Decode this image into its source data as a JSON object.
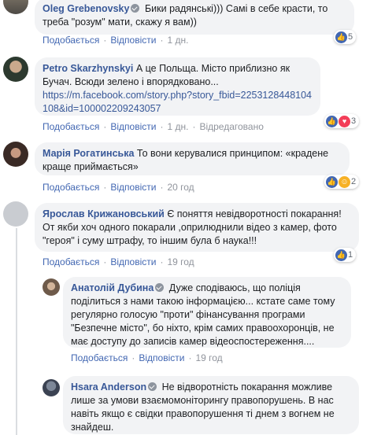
{
  "comments": [
    {
      "author": "Oleg Grebenovsky",
      "text": "Бики радянські))) Самі в себе красти, то треба \"розум\" мати, скажу я вам))",
      "like": "Подобається",
      "reply": "Відповісти",
      "time": "1 дн.",
      "reactions_count": "5"
    },
    {
      "author": "Petro Skarzhynskyi",
      "text": "А це Польща. Місто приблизно як Бучач. Всюди зелено і впорядковано...",
      "link": "https://m.facebook.com/story.php?story_fbid=2253128448104108&id=100002209243057",
      "like": "Подобається",
      "reply": "Відповісти",
      "time": "1 дн.",
      "edited": "Відредаговано",
      "reactions_count": "3"
    },
    {
      "author": "Марія Рогатинська",
      "text": "То вони керувалися принципом: «крадене краще приймається»",
      "like": "Подобається",
      "reply": "Відповісти",
      "time": "20 год",
      "reactions_count": "2"
    },
    {
      "author": "Ярослав Крижановський",
      "text": "Є поняття невідворотності покарання! От якби хоч одного покарали ,оприлюднили відео з камер, фото \"героя\" і суму штрафу, то іншим була б наука!!!",
      "like": "Подобається",
      "reply": "Відповісти",
      "time": "19 год",
      "reactions_count": "1"
    },
    {
      "author": "Анатолій Дубина",
      "text": "Дуже сподіваюсь, що поліція поділиться з нами такою інформацією... кстате саме тому регулярно голосую \"проти\" фінансування програми \"Безпечне місто\", бо ніхто, крім самих правоохоронців, не має доступу до записів камер відеоспостереження....",
      "like": "Подобається",
      "reply": "Відповісти",
      "time": "19 год"
    },
    {
      "author": "Hsara Anderson",
      "text": "Не відворотність покарання можливе лише за умови взаємомоніторингу правопорушень. В нас навіть якщо є свідки правопорушення ті днем з вогнем не знайдеш."
    }
  ],
  "separator": "·",
  "colors": {
    "author": "#385898",
    "action": "#4267b2",
    "meta": "#90949c",
    "bubble": "#f2f3f5"
  }
}
